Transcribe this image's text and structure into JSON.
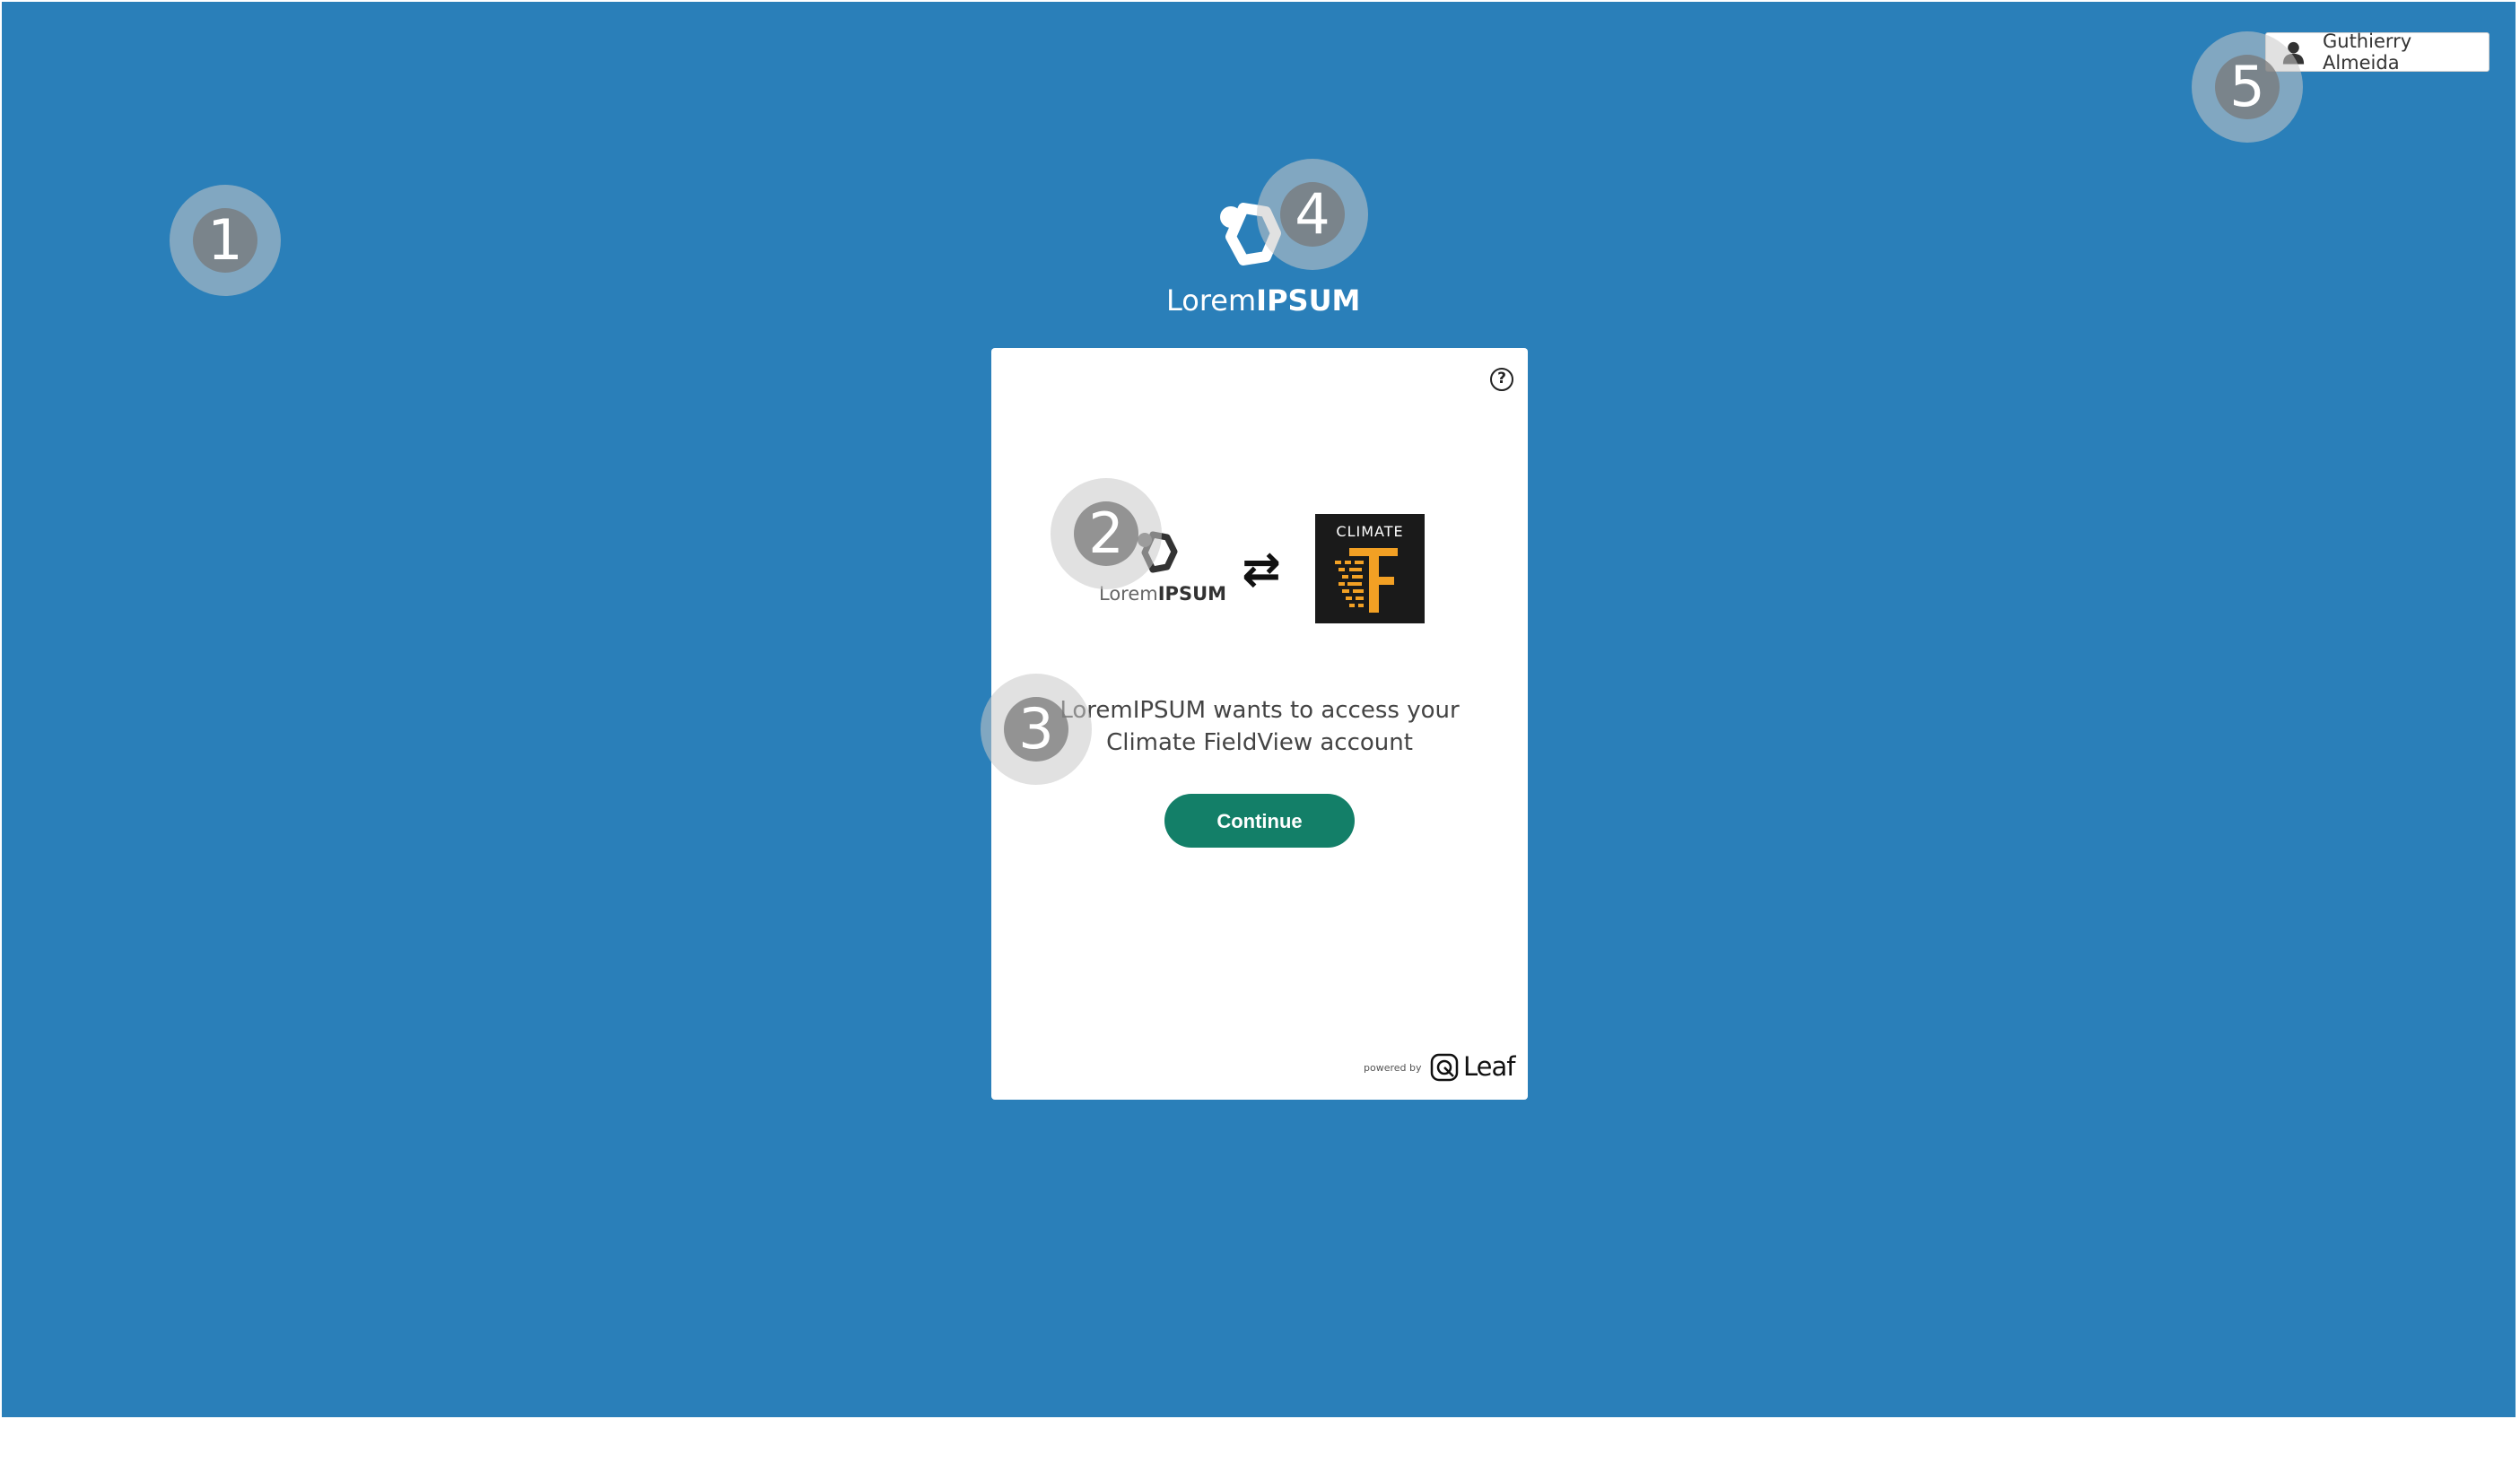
{
  "user": {
    "name": "Guthierry Almeida",
    "avatar_icon": "person-icon"
  },
  "brand": {
    "name_light": "Lorem",
    "name_bold": "IPSUM"
  },
  "card": {
    "help_icon": "?",
    "swap_icon": "⇄",
    "partner_logo_label": "CLIMATE",
    "message_line1": "LoremIPSUM wants to access your",
    "message_line2": "Climate FieldView account",
    "continue_label": "Continue",
    "powered_by": "powered by",
    "provider": "Leaf"
  },
  "markers": [
    "1",
    "2",
    "3",
    "4",
    "5"
  ],
  "colors": {
    "background": "#2a7fb9",
    "button": "#137f68",
    "accent_orange": "#f2a024"
  }
}
